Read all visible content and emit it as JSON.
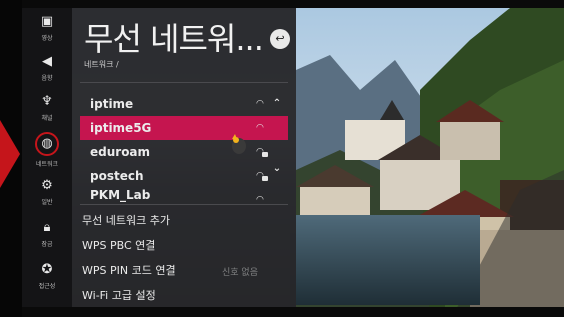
{
  "rail": {
    "items": [
      {
        "label": "영상",
        "icon": "picture-icon"
      },
      {
        "label": "음향",
        "icon": "speaker-icon"
      },
      {
        "label": "채널",
        "icon": "antenna-icon"
      },
      {
        "label": "네트워크",
        "icon": "globe-icon"
      },
      {
        "label": "일반",
        "icon": "general-icon"
      },
      {
        "label": "잠금",
        "icon": "lock-icon"
      },
      {
        "label": "접근성",
        "icon": "accessibility-icon"
      }
    ]
  },
  "panel": {
    "title": "무선 네트워...",
    "breadcrumb": "네트워크 /",
    "back_icon": "↩"
  },
  "networks": [
    {
      "name": "iptime",
      "secured": false,
      "selected": false
    },
    {
      "name": "iptime5G",
      "secured": false,
      "selected": true
    },
    {
      "name": "eduroam",
      "secured": true,
      "selected": false
    },
    {
      "name": "postech",
      "secured": true,
      "selected": false
    },
    {
      "name": "PKM_Lab",
      "secured": false,
      "selected": false
    }
  ],
  "menu": {
    "add_network": "무선 네트워크 추가",
    "wps_pbc": "WPS PBC 연결",
    "wps_pin": "WPS PIN 코드 연결",
    "wifi_advanced": "Wi-Fi 고급 설정"
  },
  "background_hint": "신호 없음",
  "colors": {
    "accent": "#c5154f",
    "marker": "#c5151b",
    "panel": "#26262a"
  }
}
